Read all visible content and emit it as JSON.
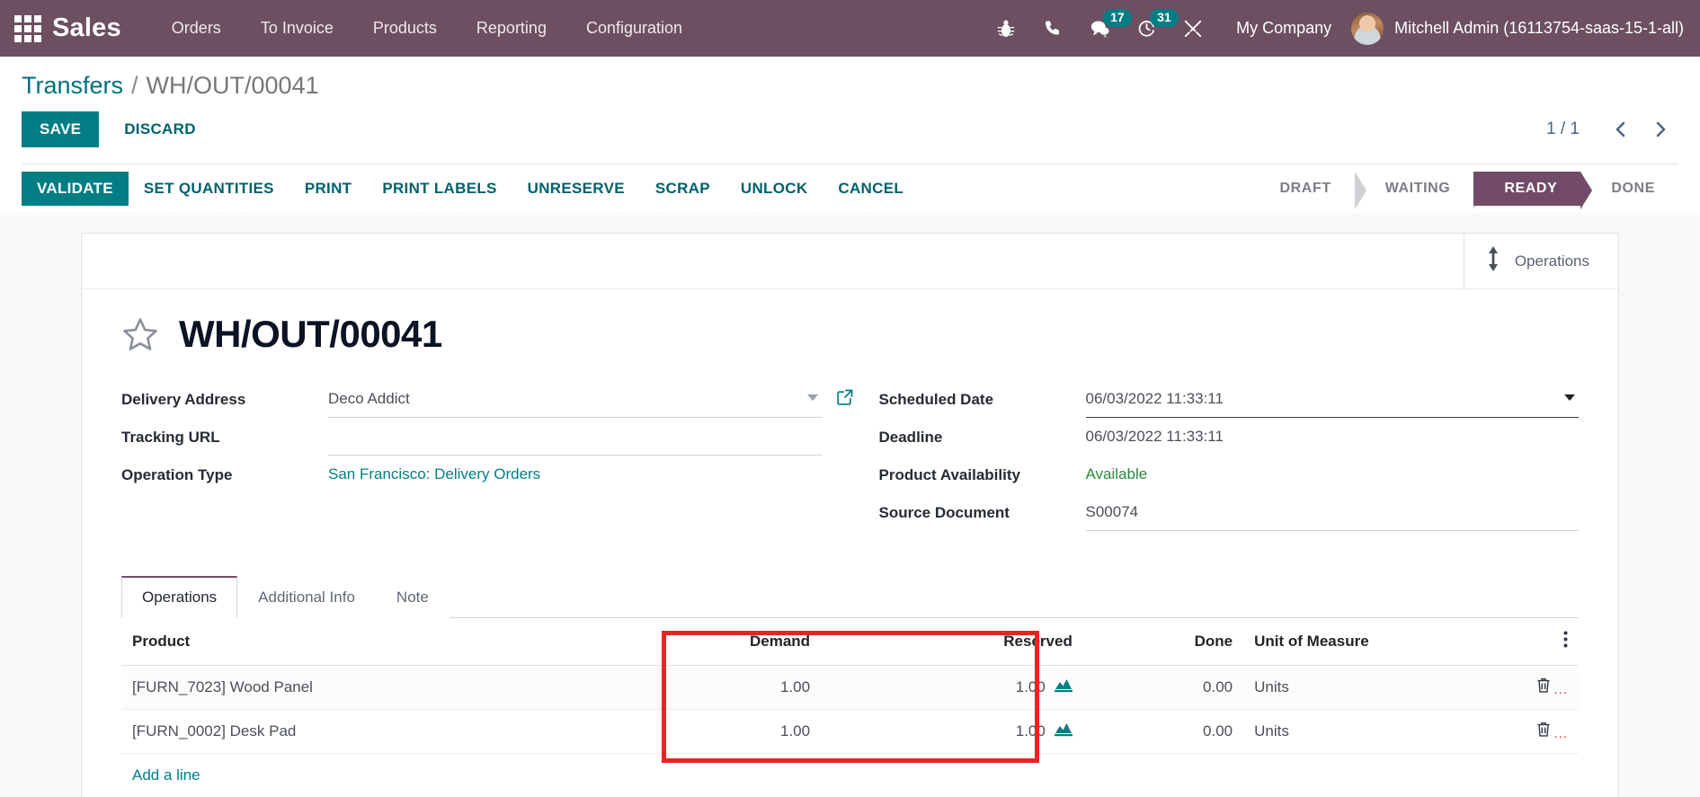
{
  "navbar": {
    "apps_icon": "apps-grid-icon",
    "brand": "Sales",
    "menu": [
      "Orders",
      "To Invoice",
      "Products",
      "Reporting",
      "Configuration"
    ],
    "sys_icons": [
      {
        "name": "bug-icon",
        "badge": null
      },
      {
        "name": "phone-icon",
        "badge": null
      },
      {
        "name": "messages-icon",
        "badge": "17"
      },
      {
        "name": "activities-clock-icon",
        "badge": "31"
      },
      {
        "name": "tools-icon",
        "badge": null
      }
    ],
    "company": "My Company",
    "user": "Mitchell Admin (16113754-saas-15-1-all)",
    "accent": "#6d4f62",
    "badge_color": "#017e84"
  },
  "breadcrumb": {
    "parent": "Transfers",
    "separator": "/",
    "current": "WH/OUT/00041"
  },
  "actions": {
    "save": "SAVE",
    "discard": "DISCARD",
    "pager": "1 / 1",
    "prev_icon": "chevron-left-icon",
    "next_icon": "chevron-right-icon"
  },
  "statusbar_buttons": [
    {
      "label": "VALIDATE",
      "primary": true
    },
    {
      "label": "SET QUANTITIES",
      "primary": false
    },
    {
      "label": "PRINT",
      "primary": false
    },
    {
      "label": "PRINT LABELS",
      "primary": false
    },
    {
      "label": "UNRESERVE",
      "primary": false
    },
    {
      "label": "SCRAP",
      "primary": false
    },
    {
      "label": "UNLOCK",
      "primary": false
    },
    {
      "label": "CANCEL",
      "primary": false
    }
  ],
  "status_pipeline": [
    {
      "label": "DRAFT",
      "active": false
    },
    {
      "label": "WAITING",
      "active": false
    },
    {
      "label": "READY",
      "active": true
    },
    {
      "label": "DONE",
      "active": false
    }
  ],
  "status_active_color": "#714b67",
  "smart_button": {
    "icon": "arrows-vertical-icon",
    "label": "Operations"
  },
  "record": {
    "star_icon": "star-outline-icon",
    "title": "WH/OUT/00041"
  },
  "form": {
    "left": [
      {
        "label": "Delivery Address",
        "value": "Deco Addict",
        "style": "input-caret-ext"
      },
      {
        "label": "Tracking URL",
        "value": "",
        "style": "input"
      },
      {
        "label": "Operation Type",
        "value": "San Francisco: Delivery Orders",
        "style": "link"
      }
    ],
    "right": [
      {
        "label": "Scheduled Date",
        "value": "06/03/2022 11:33:11",
        "style": "input-caret-strong"
      },
      {
        "label": "Deadline",
        "value": "06/03/2022 11:33:11",
        "style": "readonly"
      },
      {
        "label": "Product Availability",
        "value": "Available",
        "style": "green"
      },
      {
        "label": "Source Document",
        "value": "S00074",
        "style": "input"
      }
    ]
  },
  "notebook": {
    "tabs": [
      {
        "label": "Operations",
        "active": true
      },
      {
        "label": "Additional Info",
        "active": false
      },
      {
        "label": "Note",
        "active": false
      }
    ]
  },
  "lines_table": {
    "columns": [
      "Product",
      "Demand",
      "Reserved",
      "Done",
      "Unit of Measure"
    ],
    "optional_columns_icon": "vertical-dots-icon",
    "rows": [
      {
        "product": "[FURN_7023] Wood Panel",
        "demand": "1.00",
        "reserved": "1.00",
        "reserved_icon": "forecast-chart-icon",
        "done": "0.00",
        "uom": "Units",
        "delete_icon": "trash-icon"
      },
      {
        "product": "[FURN_0002] Desk Pad",
        "demand": "1.00",
        "reserved": "1.00",
        "reserved_icon": "forecast-chart-icon",
        "done": "0.00",
        "uom": "Units",
        "delete_icon": "trash-icon"
      }
    ],
    "add_line": "Add a line"
  },
  "annotation": {
    "color": "#ee2222",
    "covers": "Demand and Reserved columns"
  }
}
